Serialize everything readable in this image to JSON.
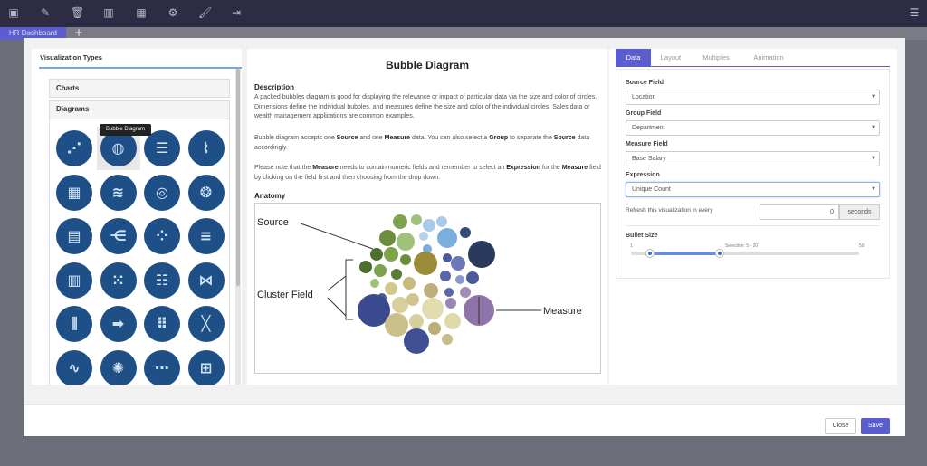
{
  "topbar": {
    "icons": [
      "save-icon",
      "edit-icon",
      "trash-icon",
      "bar-chart-icon",
      "grid-icon",
      "gear-icon",
      "brush-icon",
      "exit-icon",
      "menu-icon"
    ]
  },
  "tabs": {
    "active_label": "HR Dashboard",
    "add_label": "+"
  },
  "left_panel": {
    "title": "Visualization Types",
    "charts_label": "Charts",
    "diagrams_label": "Diagrams",
    "tooltip": "Bubble Diagram",
    "diagram_icons": [
      "scatter-icon",
      "bubble-icon",
      "bars-icon",
      "area-line-icon",
      "table-grid-icon",
      "wave-icon",
      "radial-icon",
      "circle-pack-icon",
      "heatmap-icon",
      "tree-icon",
      "network-icon",
      "gantt-icon",
      "matrix-icon",
      "dots-icon",
      "bar-list-icon",
      "node-graph-icon",
      "parallel-icon",
      "flow-icon",
      "dot-matrix-icon",
      "crossing-lines-icon",
      "spark-wave-icon",
      "sunburst-icon",
      "scatter-axis-icon",
      "org-chart-icon"
    ]
  },
  "middle": {
    "title": "Bubble Diagram",
    "description_heading": "Description",
    "description": "A packed bubbles diagram is good for displaying the relevance or impact of particular data via the size and color of circles. Dimensions define the individual bubbles, and measures define the size and color of the individual circles. Sales data or wealth management applications are common examples.",
    "p2_a": "Bubble diagram accepts one ",
    "p2_source": "Source",
    "p2_b": " and one ",
    "p2_measure": "Measure",
    "p2_c": " data. You can also select a ",
    "p2_group": "Group",
    "p2_d": " to separate the ",
    "p2_source2": "Source",
    "p2_e": " data accordingly.",
    "p3_a": "Please note that the ",
    "p3_measure": "Measure",
    "p3_b": " needs to contain numeric fields and remember to select an ",
    "p3_expression": "Expression",
    "p3_c": " for the ",
    "p3_measure2": "Measure",
    "p3_d": " field by clicking on the field first and then choosing from the drop down.",
    "anatomy_heading": "Anatomy",
    "anatomy_labels": {
      "source": "Source",
      "cluster": "Cluster Field",
      "measure": "Measure"
    }
  },
  "right_panel": {
    "tabs": [
      "Data",
      "Layout",
      "Multiples",
      "Animation"
    ],
    "source_field_label": "Source Field",
    "source_field_value": "Location",
    "group_field_label": "Group Field",
    "group_field_value": "Department",
    "measure_field_label": "Measure Field",
    "measure_field_value": "Base Salary",
    "expression_label": "Expression",
    "expression_value": "Unique Count",
    "refresh_label": "Refresh this visualization in every",
    "refresh_value": "0",
    "refresh_unit": "seconds",
    "bullet_size_label": "Bullet Size",
    "slider_min": "1",
    "slider_max": "50",
    "slider_selection": "Selection: 5 - 20",
    "slider_low": 5,
    "slider_high": 20
  },
  "footer": {
    "close_label": "Close",
    "save_label": "Save"
  },
  "colors": {
    "accent": "#5b5ecf",
    "icon_circle": "#1e4f86",
    "topbar": "#2e2c45"
  }
}
